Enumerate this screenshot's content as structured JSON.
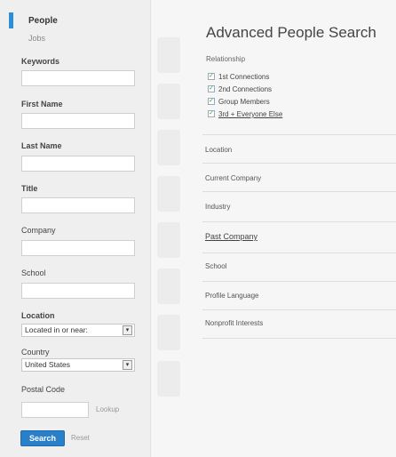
{
  "sidebar": {
    "tabs": {
      "active": "People",
      "inactive": "Jobs"
    },
    "keywords_label": "Keywords",
    "first_name_label": "First Name",
    "last_name_label": "Last Name",
    "title_label": "Title",
    "company_label": "Company",
    "school_label": "School",
    "location_label": "Location",
    "location_value": "Located in or near:",
    "country_label": "Country",
    "country_value": "United States",
    "postal_label": "Postal Code",
    "lookup_label": "Lookup",
    "search_label": "Search",
    "reset_label": "Reset"
  },
  "main": {
    "title": "Advanced People Search",
    "relationship_label": "Relationship",
    "relationships": [
      {
        "label": "1st Connections",
        "checked": true
      },
      {
        "label": "2nd Connections",
        "checked": true
      },
      {
        "label": "Group Members",
        "checked": true
      },
      {
        "label": "3rd + Everyone Else",
        "checked": true
      }
    ],
    "filters": [
      "Location",
      "Current Company",
      "Industry",
      "Past Company",
      "School",
      "Profile Language",
      "Nonprofit Interests"
    ]
  },
  "colors": {
    "accent": "#2a8fd6",
    "button": "#2a7fc9",
    "check": "#3a9a3a"
  },
  "icons": {
    "select": "dropdown-arrow-icon",
    "check": "checkmark-icon"
  }
}
